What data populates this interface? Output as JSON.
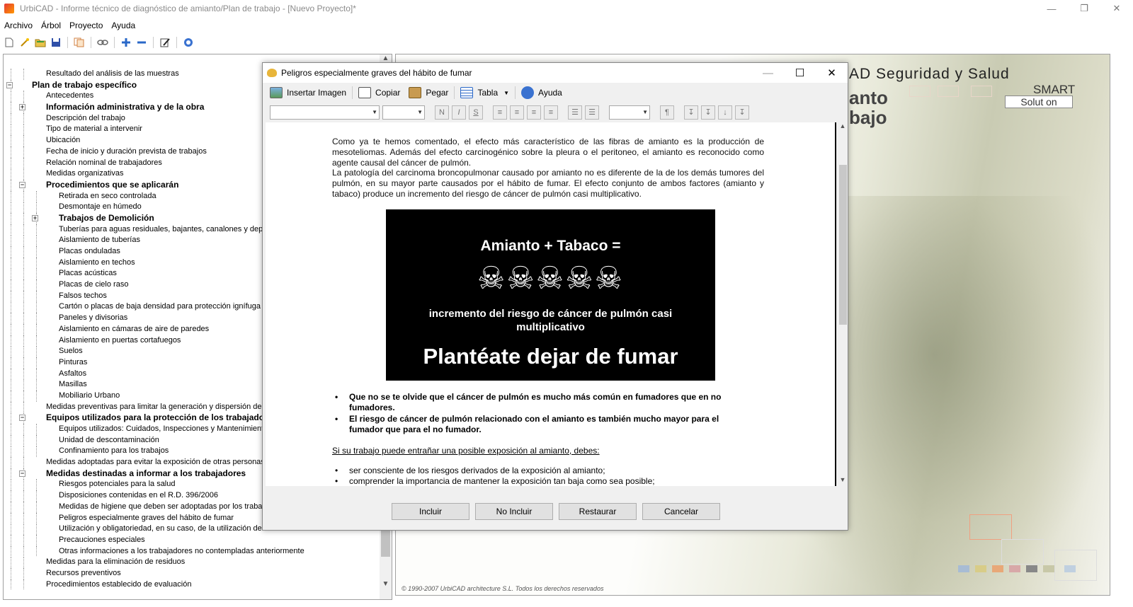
{
  "window": {
    "title": "UrbiCAD - Informe técnico de diagnóstico de amianto/Plan de trabajo  - [Nuevo Proyecto]*",
    "min": "—",
    "max": "❐",
    "close": "✕"
  },
  "menu": [
    "Archivo",
    "Árbol",
    "Proyecto",
    "Ayuda"
  ],
  "tree": [
    {
      "label": "Resultado del análisis de las muestras",
      "level": 2,
      "bold": false
    },
    {
      "label": "Plan de trabajo específico",
      "level": 1,
      "bold": true,
      "expander": "−"
    },
    {
      "label": "Antecedentes",
      "level": 2,
      "bold": false
    },
    {
      "label": "Información administrativa y de la obra",
      "level": 2,
      "bold": true,
      "expander": "+"
    },
    {
      "label": "Descripción del trabajo",
      "level": 2,
      "bold": false
    },
    {
      "label": "Tipo de material a intervenir",
      "level": 2,
      "bold": false
    },
    {
      "label": "Ubicación",
      "level": 2,
      "bold": false
    },
    {
      "label": "Fecha de inicio y duración prevista de trabajos",
      "level": 2,
      "bold": false
    },
    {
      "label": "Relación nominal de trabajadores",
      "level": 2,
      "bold": false
    },
    {
      "label": "Medidas organizativas",
      "level": 2,
      "bold": false
    },
    {
      "label": "Procedimientos que se aplicarán",
      "level": 2,
      "bold": true,
      "expander": "−"
    },
    {
      "label": "Retirada en seco controlada",
      "level": 3,
      "bold": false
    },
    {
      "label": "Desmontaje en húmedo",
      "level": 3,
      "bold": false
    },
    {
      "label": "Trabajos de Demolición",
      "level": 3,
      "bold": true,
      "expander": "+"
    },
    {
      "label": "Tuberías para aguas residuales, bajantes, canalones y depósitos",
      "level": 3,
      "bold": false
    },
    {
      "label": "Aislamiento de tuberías",
      "level": 3,
      "bold": false
    },
    {
      "label": "Placas onduladas",
      "level": 3,
      "bold": false
    },
    {
      "label": "Aislamiento en techos",
      "level": 3,
      "bold": false
    },
    {
      "label": "Placas acústicas",
      "level": 3,
      "bold": false
    },
    {
      "label": "Placas de cielo raso",
      "level": 3,
      "bold": false
    },
    {
      "label": "Falsos techos",
      "level": 3,
      "bold": false
    },
    {
      "label": "Cartón o placas de baja densidad para protección ignífuga",
      "level": 3,
      "bold": false
    },
    {
      "label": "Paneles y divisorias",
      "level": 3,
      "bold": false
    },
    {
      "label": "Aislamiento en cámaras de aire de paredes",
      "level": 3,
      "bold": false
    },
    {
      "label": "Aislamiento en puertas cortafuegos",
      "level": 3,
      "bold": false
    },
    {
      "label": "Suelos",
      "level": 3,
      "bold": false
    },
    {
      "label": "Pinturas",
      "level": 3,
      "bold": false
    },
    {
      "label": "Asfaltos",
      "level": 3,
      "bold": false
    },
    {
      "label": "Masillas",
      "level": 3,
      "bold": false
    },
    {
      "label": "Mobiliario Urbano",
      "level": 3,
      "bold": false
    },
    {
      "label": "Medidas preventivas para limitar la generación y dispersión de fibras",
      "level": 2,
      "bold": false
    },
    {
      "label": "Equipos utilizados para la protección de los trabajadores",
      "level": 2,
      "bold": true,
      "expander": "−"
    },
    {
      "label": "Equipos utilizados: Cuidados, Inspecciones y Mantenimientos",
      "level": 3,
      "bold": false
    },
    {
      "label": "Unidad de descontaminación",
      "level": 3,
      "bold": false
    },
    {
      "label": "Confinamiento para los trabajos",
      "level": 3,
      "bold": false
    },
    {
      "label": "Medidas adoptadas para evitar la exposición de otras personas",
      "level": 2,
      "bold": false
    },
    {
      "label": "Medidas destinadas a informar a los trabajadores",
      "level": 2,
      "bold": true,
      "expander": "−"
    },
    {
      "label": "Riesgos potenciales para la salud",
      "level": 3,
      "bold": false
    },
    {
      "label": "Disposiciones contenidas en el R.D. 396/2006",
      "level": 3,
      "bold": false
    },
    {
      "label": "Medidas de higiene que deben ser adoptadas por los trabajadores",
      "level": 3,
      "bold": false
    },
    {
      "label": "Peligros especialmente graves del hábito de fumar",
      "level": 3,
      "bold": false
    },
    {
      "label": "Utilización y obligatoriedad, en su caso, de la utilización de los EPIS",
      "level": 3,
      "bold": false
    },
    {
      "label": "Precauciones especiales",
      "level": 3,
      "bold": false
    },
    {
      "label": "Otras informaciones a los trabajadores no contempladas anteriormente",
      "level": 3,
      "bold": false
    },
    {
      "label": "Medidas para la eliminación de residuos",
      "level": 2,
      "bold": false
    },
    {
      "label": "Recursos preventivos",
      "level": 2,
      "bold": false
    },
    {
      "label": "Procedimientos establecido de evaluación",
      "level": 2,
      "bold": false
    }
  ],
  "background_panel": {
    "title": "AD Seguridad y Salud",
    "sub1": "anto",
    "sub2": "bajo",
    "smart": "SMART",
    "solution": "Solut on",
    "copyright": "© 1990-2007 UrbiCAD architecture S.L. Todos los derechos reservados"
  },
  "dialog": {
    "title": "Peligros especialmente graves del hábito de fumar",
    "toolbar": {
      "insert_image": "Insertar Imagen",
      "copy": "Copiar",
      "paste": "Pegar",
      "table": "Tabla",
      "help": "Ayuda"
    },
    "format": {
      "bold": "N",
      "italic": "I",
      "strike": "S",
      "align_left": "≡",
      "align_center": "≡",
      "align_right": "≡",
      "justify": "≡",
      "bullets": "☰",
      "numbers": "☰",
      "paragraph": "¶",
      "indent1": "↧",
      "indent2": "↧",
      "indent3": "↓",
      "indent4": "↧"
    },
    "content": {
      "p1": "Como ya te hemos comentado, el efecto más característico de las fibras de amianto es la producción de mesoteliomas. Además del efecto carcinogénico sobre la pleura o el peritoneo, el amianto es reconocido como agente causal del cáncer de pulmón.",
      "p2": "La patología del carcinoma broncopulmonar causado por amianto no es diferente de la de los demás tumores del pulmón, en su mayor parte causados por el hábito de fumar. El efecto conjunto de ambos factores (amianto y tabaco) produce un incremento del riesgo de cáncer de pulmón casi multiplicativo.",
      "banner_heading": "Amianto + Tabaco =",
      "banner_skulls": "☠☠☠☠☠",
      "banner_sub": "incremento del riesgo de cáncer de pulmón casi multiplicativo",
      "banner_big": "Plantéate dejar de fumar",
      "bullet1": "Que no se te olvide que el cáncer de pulmón es mucho más común en fumadores que en no fumadores.",
      "bullet2": "El riesgo de cáncer de pulmón relacionado con el amianto es también mucho mayor para el fumador que para el no fumador.",
      "underline": "Si su trabajo puede entrañar una posible exposición al amianto, debes:",
      "bullet3": "ser consciente de los riesgos derivados de la exposición al amianto;",
      "bullet4": "comprender la importancia de mantener la exposición tan baja como sea posible;"
    },
    "buttons": {
      "include": "Incluir",
      "not_include": "No Incluir",
      "restore": "Restaurar",
      "cancel": "Cancelar"
    },
    "ctrls": {
      "min": "—",
      "max": "☐",
      "close": "✕"
    }
  },
  "colors": {
    "accent": "#2b6cb0",
    "banner_bg": "#000000"
  }
}
